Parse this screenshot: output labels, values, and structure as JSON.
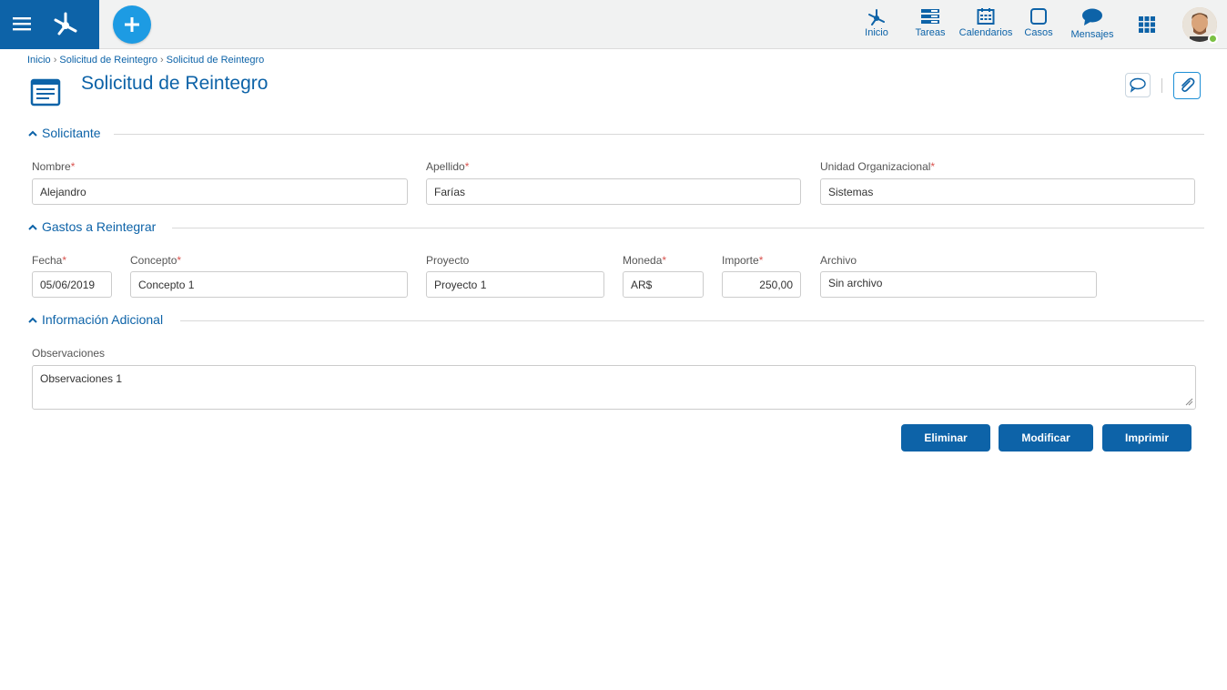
{
  "topbar": {
    "nav": [
      {
        "label": "Inicio",
        "icon": "home-network-icon"
      },
      {
        "label": "Tareas",
        "icon": "tasks-icon"
      },
      {
        "label": "Calendarios",
        "icon": "calendar-icon"
      },
      {
        "label": "Casos",
        "icon": "cases-icon"
      },
      {
        "label": "Mensajes",
        "icon": "chat-icon"
      }
    ],
    "accent": "#0d63a8",
    "add_color": "#1d9be3"
  },
  "breadcrumb": [
    "Inicio",
    "Solicitud de Reintegro",
    "Solicitud de Reintegro"
  ],
  "page": {
    "title": "Solicitud de Reintegro"
  },
  "sections": {
    "solicitante": {
      "title": "Solicitante",
      "nombre": {
        "label": "Nombre",
        "value": "Alejandro"
      },
      "apellido": {
        "label": "Apellido",
        "value": "Farías"
      },
      "unidad": {
        "label": "Unidad Organizacional",
        "value": "Sistemas"
      }
    },
    "gastos": {
      "title": "Gastos a Reintegrar",
      "fecha": {
        "label": "Fecha",
        "value": "05/06/2019"
      },
      "concepto": {
        "label": "Concepto",
        "value": "Concepto 1"
      },
      "proyecto": {
        "label": "Proyecto",
        "value": "Proyecto 1"
      },
      "moneda": {
        "label": "Moneda",
        "value": "AR$"
      },
      "importe": {
        "label": "Importe",
        "value": "250,00"
      },
      "archivo": {
        "label": "Archivo",
        "value": "Sin archivo"
      }
    },
    "info": {
      "title": "Información Adicional",
      "observaciones": {
        "label": "Observaciones",
        "value": "Observaciones 1"
      }
    }
  },
  "actions": {
    "eliminar": "Eliminar",
    "modificar": "Modificar",
    "imprimir": "Imprimir"
  },
  "required_mark": "*"
}
